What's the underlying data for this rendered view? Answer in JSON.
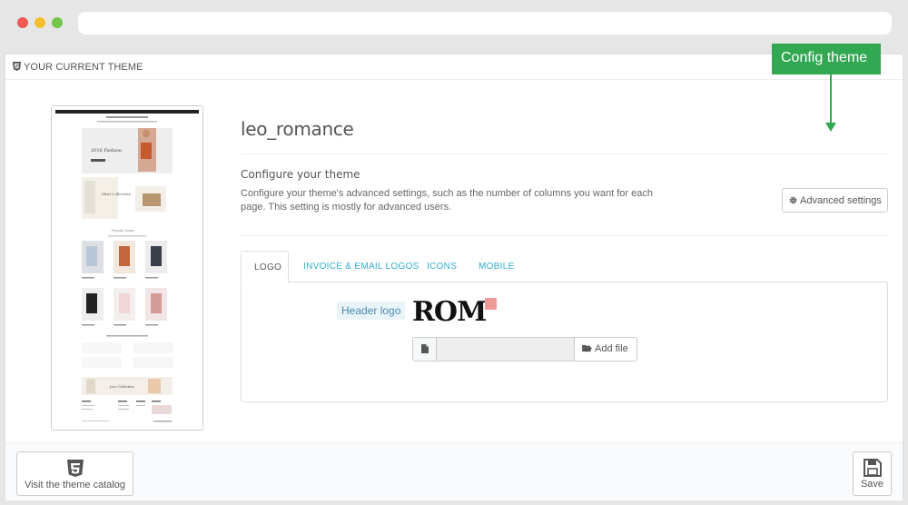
{
  "browser": {
    "url": ""
  },
  "panel": {
    "heading": "YOUR CURRENT THEME"
  },
  "theme": {
    "name": "leo_romance",
    "configure_title": "Configure your theme",
    "configure_desc": "Configure your theme's advanced settings, such as the number of columns you want for each page. This setting is mostly for advanced users.",
    "advanced_button": "Advanced settings"
  },
  "callout": {
    "label": "Config theme",
    "color": "#33a852"
  },
  "tabs": [
    {
      "label": "LOGO",
      "active": true
    },
    {
      "label": "INVOICE & EMAIL LOGOS",
      "active": false
    },
    {
      "label": "ICONS",
      "active": false
    },
    {
      "label": "MOBILE",
      "active": false
    }
  ],
  "logo": {
    "label": "Header logo",
    "preview_text": "ROM",
    "add_file_label": "Add file"
  },
  "footer": {
    "visit_label": "Visit the theme catalog",
    "save_label": "Save"
  },
  "icons": {
    "heading": "html5-icon",
    "advanced": "gear-icon",
    "file": "file-icon",
    "add_file": "folder-open-icon",
    "visit": "html5-icon",
    "save": "floppy-disk-icon"
  },
  "preview_image": {
    "title": "2016 Fashion",
    "collection": "Shirt Collection",
    "section": "Popular Items",
    "jace": "Jace Collection"
  }
}
